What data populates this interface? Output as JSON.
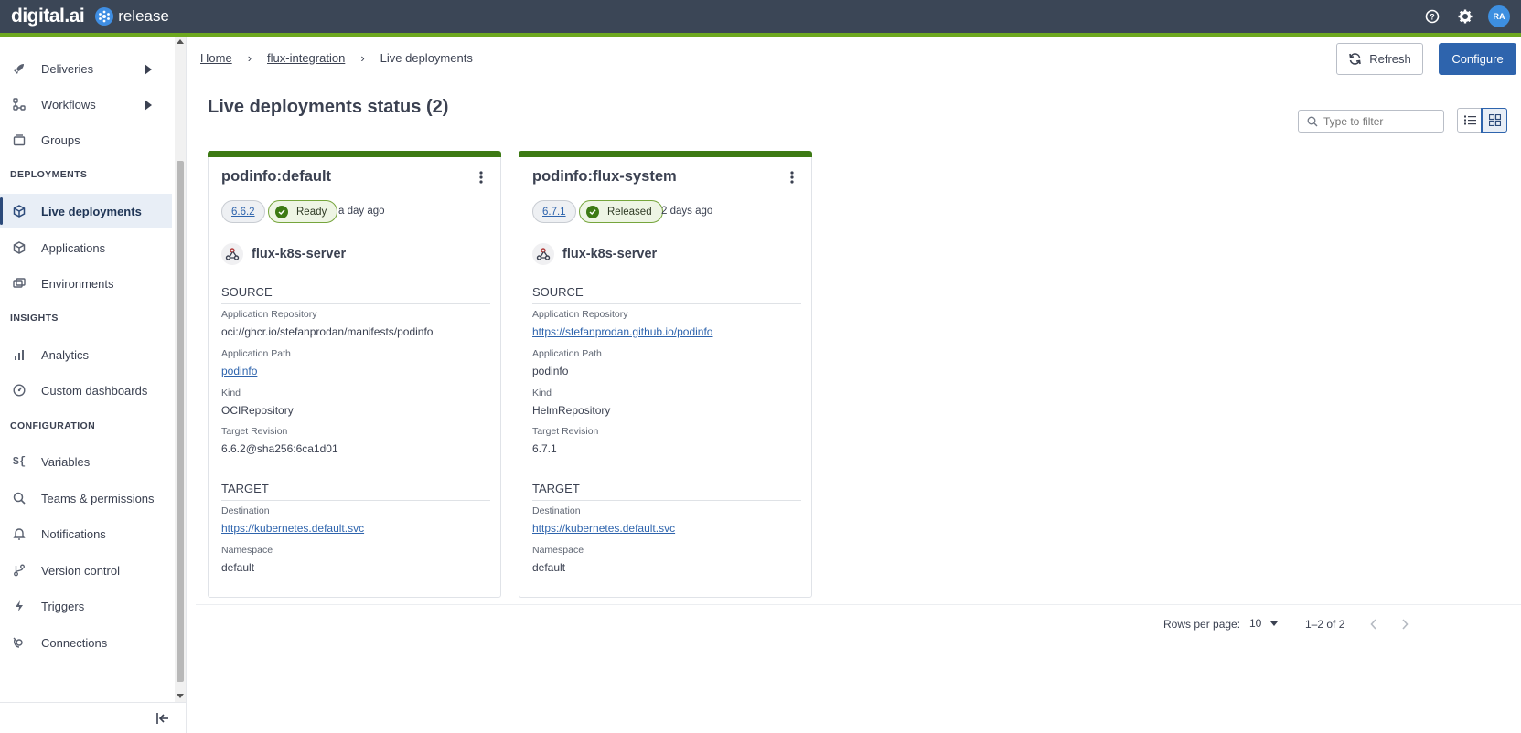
{
  "header": {
    "brand_name": "digital.ai",
    "product_name": "release",
    "help_icon": "help-circle-icon",
    "settings_icon": "gear-icon",
    "user_initials": "RA"
  },
  "sidebar": {
    "items_top": [
      {
        "label": "Deliveries",
        "icon": "rocket-icon",
        "has_submenu": true
      },
      {
        "label": "Workflows",
        "icon": "workflow-icon",
        "has_submenu": true
      },
      {
        "label": "Groups",
        "icon": "stack-icon",
        "has_submenu": false
      }
    ],
    "sections": [
      {
        "title": "DEPLOYMENTS",
        "items": [
          {
            "label": "Live deployments",
            "icon": "cube-icon",
            "active": true
          },
          {
            "label": "Applications",
            "icon": "cube-icon"
          },
          {
            "label": "Environments",
            "icon": "environment-icon"
          }
        ]
      },
      {
        "title": "INSIGHTS",
        "items": [
          {
            "label": "Analytics",
            "icon": "bar-chart-icon"
          },
          {
            "label": "Custom dashboards",
            "icon": "dashboard-gauge-icon"
          }
        ]
      },
      {
        "title": "CONFIGURATION",
        "items": [
          {
            "label": "Variables",
            "icon": "variable-icon"
          },
          {
            "label": "Teams & permissions",
            "icon": "key-search-icon"
          },
          {
            "label": "Notifications",
            "icon": "bell-icon"
          },
          {
            "label": "Version control",
            "icon": "branch-icon"
          },
          {
            "label": "Triggers",
            "icon": "lightning-icon"
          },
          {
            "label": "Connections",
            "icon": "connections-icon"
          }
        ]
      }
    ],
    "collapse_icon": "collapse-left-icon"
  },
  "breadcrumb": {
    "home": "Home",
    "folder": "flux-integration",
    "current": "Live deployments"
  },
  "actions": {
    "refresh_label": "Refresh",
    "configure_label": "Configure"
  },
  "page": {
    "title": "Live deployments status (2)",
    "filter_placeholder": "Type to filter"
  },
  "cards": [
    {
      "title": "podinfo:default",
      "version": "6.6.2",
      "status": "Ready",
      "time_ago": "a day ago",
      "server": "flux-k8s-server",
      "source_title": "SOURCE",
      "app_repo_label": "Application Repository",
      "app_repo_value": "oci://ghcr.io/stefanprodan/manifests/podinfo",
      "app_path_label": "Application Path",
      "app_path_value": "podinfo",
      "kind_label": "Kind",
      "kind_value": "OCIRepository",
      "target_rev_label": "Target Revision",
      "target_rev_value": "6.6.2@sha256:6ca1d01",
      "target_title": "TARGET",
      "destination_label": "Destination",
      "destination_value": "https://kubernetes.default.svc",
      "namespace_label": "Namespace",
      "namespace_value": "default"
    },
    {
      "title": "podinfo:flux-system",
      "version": "6.7.1",
      "status": "Released",
      "time_ago": "2 days ago",
      "server": "flux-k8s-server",
      "source_title": "SOURCE",
      "app_repo_label": "Application Repository",
      "app_repo_value": "https://stefanprodan.github.io/podinfo",
      "app_path_label": "Application Path",
      "app_path_value": "podinfo",
      "kind_label": "Kind",
      "kind_value": "HelmRepository",
      "target_rev_label": "Target Revision",
      "target_rev_value": "6.7.1",
      "target_title": "TARGET",
      "destination_label": "Destination",
      "destination_value": "https://kubernetes.default.svc",
      "namespace_label": "Namespace",
      "namespace_value": "default"
    }
  ],
  "pagination": {
    "rows_per_page_label": "Rows per page:",
    "rows_per_page_value": "10",
    "range": "1–2 of 2"
  },
  "colors": {
    "topbar": "#3b4656",
    "accent_green": "#6da81f",
    "card_status_bar": "#3d7a14",
    "primary_blue": "#2e64ad"
  }
}
